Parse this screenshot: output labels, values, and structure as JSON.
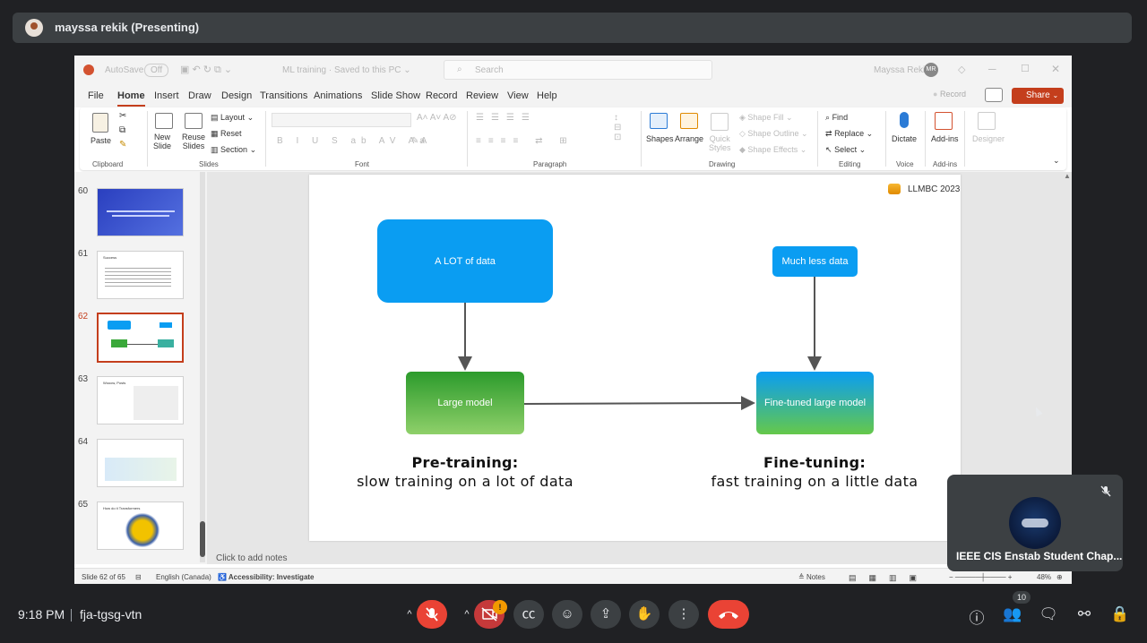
{
  "presenter": {
    "name": "mayssa rekik (Presenting)"
  },
  "ppt": {
    "titlebar": {
      "autosave": "AutoSave",
      "autosave_state": "Off",
      "filename": "ML training · Saved to this PC ⌄",
      "search_placeholder": "Search",
      "user_name": "Mayssa Rekik",
      "user_initials": "MR"
    },
    "menu": [
      "File",
      "Home",
      "Insert",
      "Draw",
      "Design",
      "Transitions",
      "Animations",
      "Slide Show",
      "Record",
      "Review",
      "View",
      "Help"
    ],
    "record_btn": "Record",
    "share_btn": "Share",
    "ribbon": {
      "paste": "Paste",
      "clipboard": "Clipboard",
      "new_slide": "New\nSlide",
      "reuse_slides": "Reuse\nSlides",
      "layout": "Layout",
      "reset": "Reset",
      "section": "Section",
      "slides": "Slides",
      "font": "Font",
      "paragraph": "Paragraph",
      "shapes": "Shapes",
      "arrange": "Arrange",
      "quick_styles": "Quick\nStyles",
      "shape_fill": "Shape Fill",
      "shape_outline": "Shape Outline",
      "shape_effects": "Shape Effects",
      "drawing": "Drawing",
      "find": "Find",
      "replace": "Replace",
      "select": "Select",
      "editing": "Editing",
      "dictate": "Dictate",
      "voice": "Voice",
      "addins": "Add-ins",
      "addins_group": "Add-ins",
      "designer": "Designer"
    },
    "thumbnails": [
      {
        "num": "60"
      },
      {
        "num": "61",
        "title": "Success"
      },
      {
        "num": "62"
      },
      {
        "num": "63",
        "title": "Wooow, Posts"
      },
      {
        "num": "64"
      },
      {
        "num": "65",
        "title": "How do it Transformers"
      }
    ],
    "slide": {
      "logo_text": "LLMBC 2023",
      "box_data_lot": "A LOT of data",
      "box_data_less": "Much less data",
      "box_large_model": "Large model",
      "box_finetuned": "Fine-tuned large model",
      "pretrain_title": "Pre-training:",
      "pretrain_sub": "slow training on a lot of data",
      "finetune_title": "Fine-tuning:",
      "finetune_sub": "fast training on a little data"
    },
    "notes_placeholder": "Click to add notes",
    "status": {
      "slide_count": "Slide 62 of 65",
      "language": "English (Canada)",
      "accessibility": "Accessibility: Investigate",
      "notes": "Notes",
      "zoom": "48%"
    }
  },
  "participant_tile": {
    "name": "IEEE CIS Enstab Student Chap..."
  },
  "meet": {
    "time": "9:18 PM",
    "meeting_code": "fja-tgsg-vtn",
    "camera_badge": "!",
    "participants_count": "10"
  }
}
